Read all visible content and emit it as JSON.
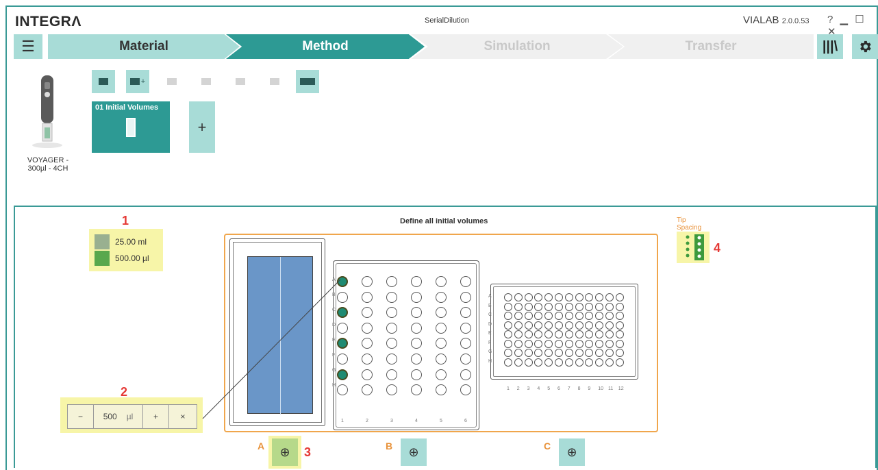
{
  "titlebar": {
    "logo": "INTEGRΛ",
    "window_title": "SerialDilution",
    "app_name": "VIALAB",
    "version": "2.0.0.53",
    "help": "?"
  },
  "steps": [
    {
      "label": "Material",
      "state": "done"
    },
    {
      "label": "Method",
      "state": "active"
    },
    {
      "label": "Simulation",
      "state": "disabled"
    },
    {
      "label": "Transfer",
      "state": "disabled"
    }
  ],
  "pipette": {
    "label_line1": "VOYAGER -",
    "label_line2": "300µl - 4CH"
  },
  "method_steps": [
    {
      "title": "01 Initial Volumes"
    }
  ],
  "add_step": "+",
  "panel": {
    "title": "Define all initial volumes",
    "callouts": [
      "1",
      "2",
      "3",
      "4"
    ],
    "legend": [
      {
        "value": "25.00 ml",
        "color": "#99b090"
      },
      {
        "value": "500.00 µl",
        "color": "#59a84d"
      }
    ],
    "tip_spacing_label_1": "Tip",
    "tip_spacing_label_2": "Spacing",
    "volume_input": {
      "minus": "−",
      "value": "500",
      "unit": "µl",
      "plus": "+",
      "clear": "×"
    },
    "plate_rows": [
      "A",
      "B",
      "C",
      "D",
      "E",
      "F",
      "G",
      "H"
    ],
    "plate24_cols": [
      "1",
      "2",
      "3",
      "4",
      "5",
      "6"
    ],
    "plate96_cols": [
      "1",
      "2",
      "3",
      "4",
      "5",
      "6",
      "7",
      "8",
      "9",
      "10",
      "11",
      "12"
    ],
    "filled_wells_col1": [
      "A",
      "C",
      "E",
      "G"
    ],
    "zoom_labels": [
      "A",
      "B",
      "C"
    ]
  },
  "colors": {
    "accent": "#2d9a94",
    "accent_light": "#a8dcd7",
    "highlight": "#f7f5a8",
    "callout": "#e53935",
    "deck_border": "#f0a64c"
  }
}
